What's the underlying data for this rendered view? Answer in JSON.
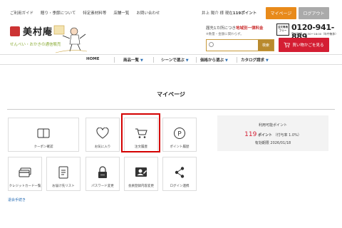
{
  "topnav": {
    "links": [
      "ご利用ガイド",
      "贈り・季節について",
      "特定素材料等",
      "店舗一覧",
      "お問い合わせ"
    ],
    "user_name": "井上 陽介 様",
    "points_prefix": "現在",
    "points_value": "119ポイント",
    "mypage_label": "マイページ",
    "logout_label": "ログアウト"
  },
  "logo": {
    "brand": "美村庵",
    "tagline": "せんべい・おかきの通信販売"
  },
  "shipping": {
    "prefix": "届先1カ所につき",
    "highlight": "地域別一律料金",
    "note": "※数量・金額に関わらず。"
  },
  "tel": {
    "badge_line1": "注文専用",
    "badge_line2": "フリー",
    "number": "0120-941-889",
    "hours": "受付時間／9:30～18:00（年中無休）"
  },
  "search": {
    "placeholder": "",
    "button_label": "検索"
  },
  "gift_button_label": "買い物かごを見る",
  "gnav": {
    "home": "HOME",
    "products": "商品一覧",
    "scene": "シーンで選ぶ",
    "price": "価格から選ぶ",
    "catalog": "カタログ請求"
  },
  "page_title": "マイページ",
  "tiles": {
    "coupon": "クーポン確認",
    "favorites": "お気に入り",
    "order_history": "注文履歴",
    "point_history": "ポイント履歴",
    "card_list": "クレジットカード一覧",
    "address_list": "お届け先リスト",
    "password": "パスワード変更",
    "member_info": "会員登録内容変更",
    "login_link": "ログイン連携"
  },
  "points": {
    "label": "利用可能ポイント",
    "value": "119",
    "unit": "ポイント",
    "rate": "（付与率 1.0%）",
    "expiry_label": "有効期限",
    "expiry_date": "2026/01/18"
  },
  "withdraw_label": "退会手続き",
  "colors": {
    "accent_orange": "#e88a1a",
    "accent_red": "#d41e33",
    "highlight_red": "#d40000",
    "link_blue": "#2a6fb6"
  }
}
